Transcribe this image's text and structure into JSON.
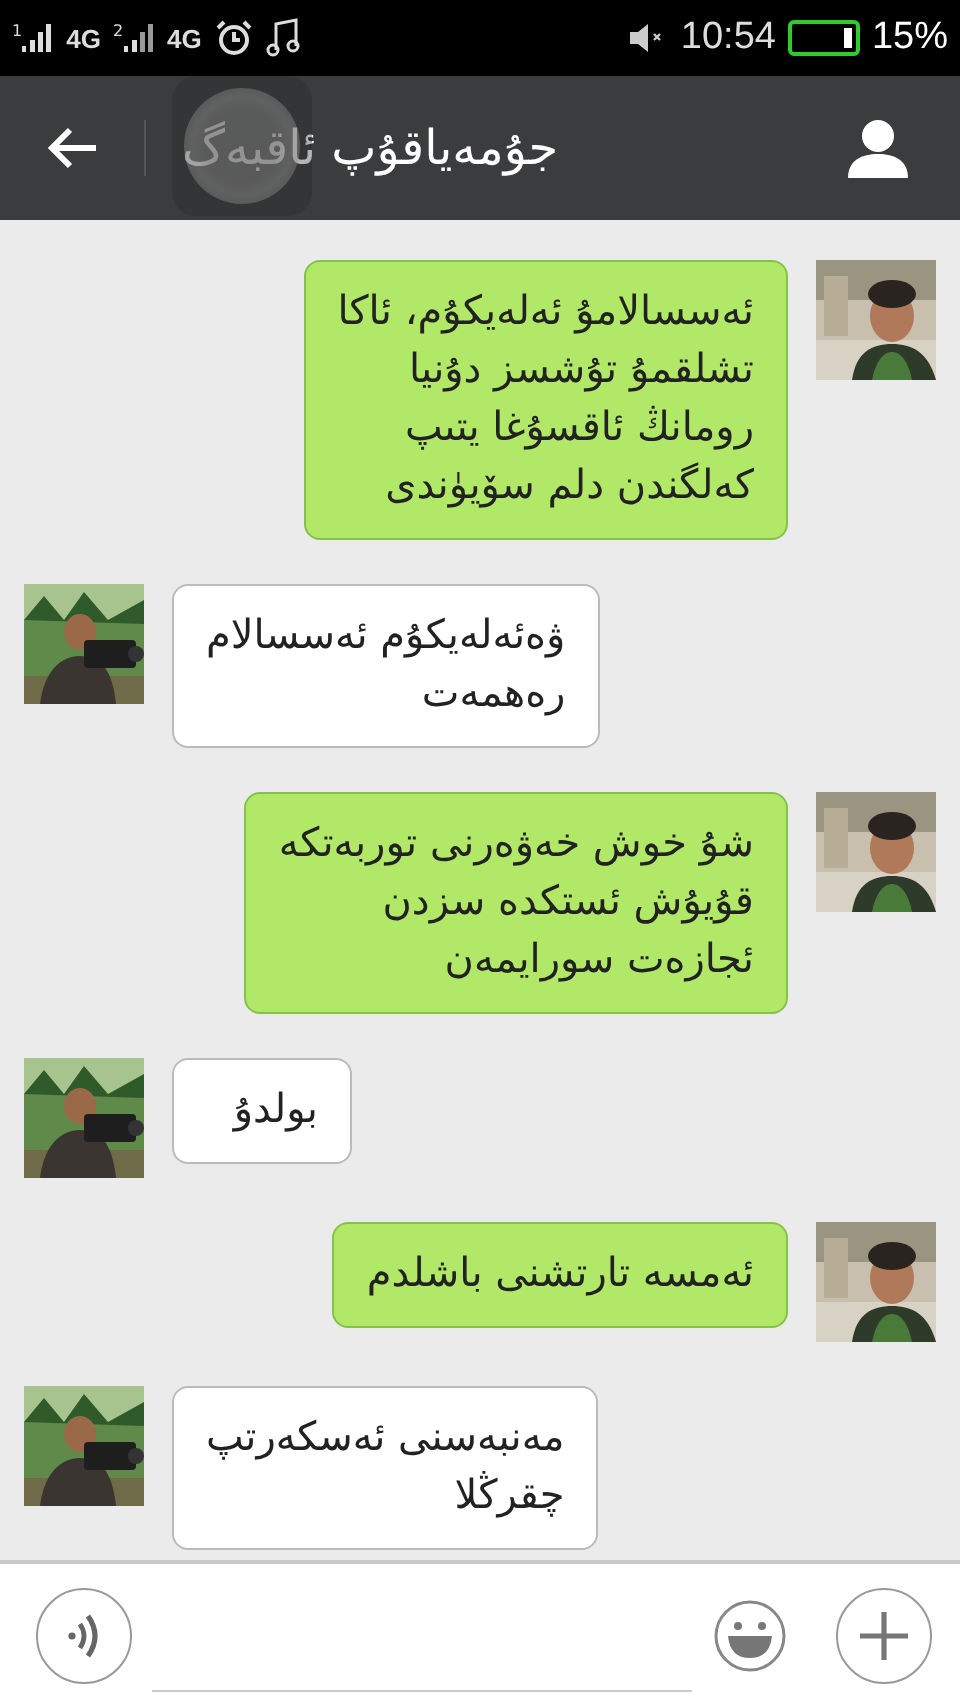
{
  "status_bar": {
    "sim1": {
      "slot": "1",
      "network": "4G"
    },
    "sim2": {
      "slot": "2",
      "network": "4G"
    },
    "time": "10:54",
    "battery": {
      "reading": "15%"
    }
  },
  "header": {
    "title": "جۇمەياقۇپ ئاقبەگ"
  },
  "messages": [
    {
      "kind": "sent",
      "text": "ئەسسالامۇ ئەلەيكۇم، ئاكا\nتشلقمۇ تۇشسز دۇنيا\nرومانڭ ئاقسۇغا يتىپ\nكەلگندن دلم سۆيۈندى"
    },
    {
      "kind": "received",
      "text": "ۋەئەلەيكۇم ئەسسالام\n رەھمەت"
    },
    {
      "kind": "sent",
      "text": "شۇ خوش خەۋەرنى توربەتكە\nقۇيۇش ئستكدە سزدن\nئجازەت سورايمەن"
    },
    {
      "kind": "received",
      "text": "بولدۇ"
    },
    {
      "kind": "sent",
      "text": "ئەمسە تارتشنى باشلدم"
    },
    {
      "kind": "received",
      "text": "مەنبەسنى ئەسكەرتپ\n چقرڭلا"
    }
  ]
}
